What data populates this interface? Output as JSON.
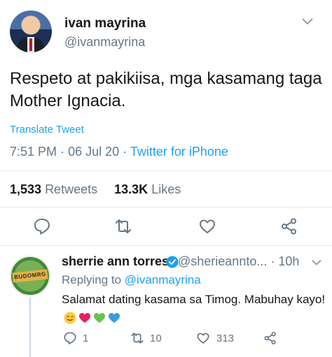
{
  "tweet": {
    "author_name": "ivan mayrina",
    "author_handle": "@ivanmayrina",
    "text": "Respeto at pakikiisa, mga kasamang taga Mother Ignacia.",
    "translate_label": "Translate Tweet",
    "time": "7:51 PM",
    "date": "06 Jul 20",
    "source": "Twitter for iPhone",
    "retweets_count": "1,533",
    "retweets_label": "Retweets",
    "likes_count": "13.3K",
    "likes_label": "Likes"
  },
  "reply": {
    "author_name": "sherrie ann torres",
    "author_handle": "@sherieannto...",
    "age": "10h",
    "replying_prefix": "Replying to",
    "replying_mention": "@ivanmayrina",
    "text": "Salamat dating kasama sa Timog. Mabuhay kayo!",
    "emojis": [
      "smiling-face",
      "red-heart",
      "green-heart",
      "blue-heart"
    ],
    "avatar_text": "BUDOMRG",
    "reply_count": "1",
    "retweet_count": "10",
    "like_count": "313"
  },
  "colors": {
    "accent": "#1da1f2",
    "secondary_text": "#657786",
    "divider": "#e1e8ed"
  }
}
